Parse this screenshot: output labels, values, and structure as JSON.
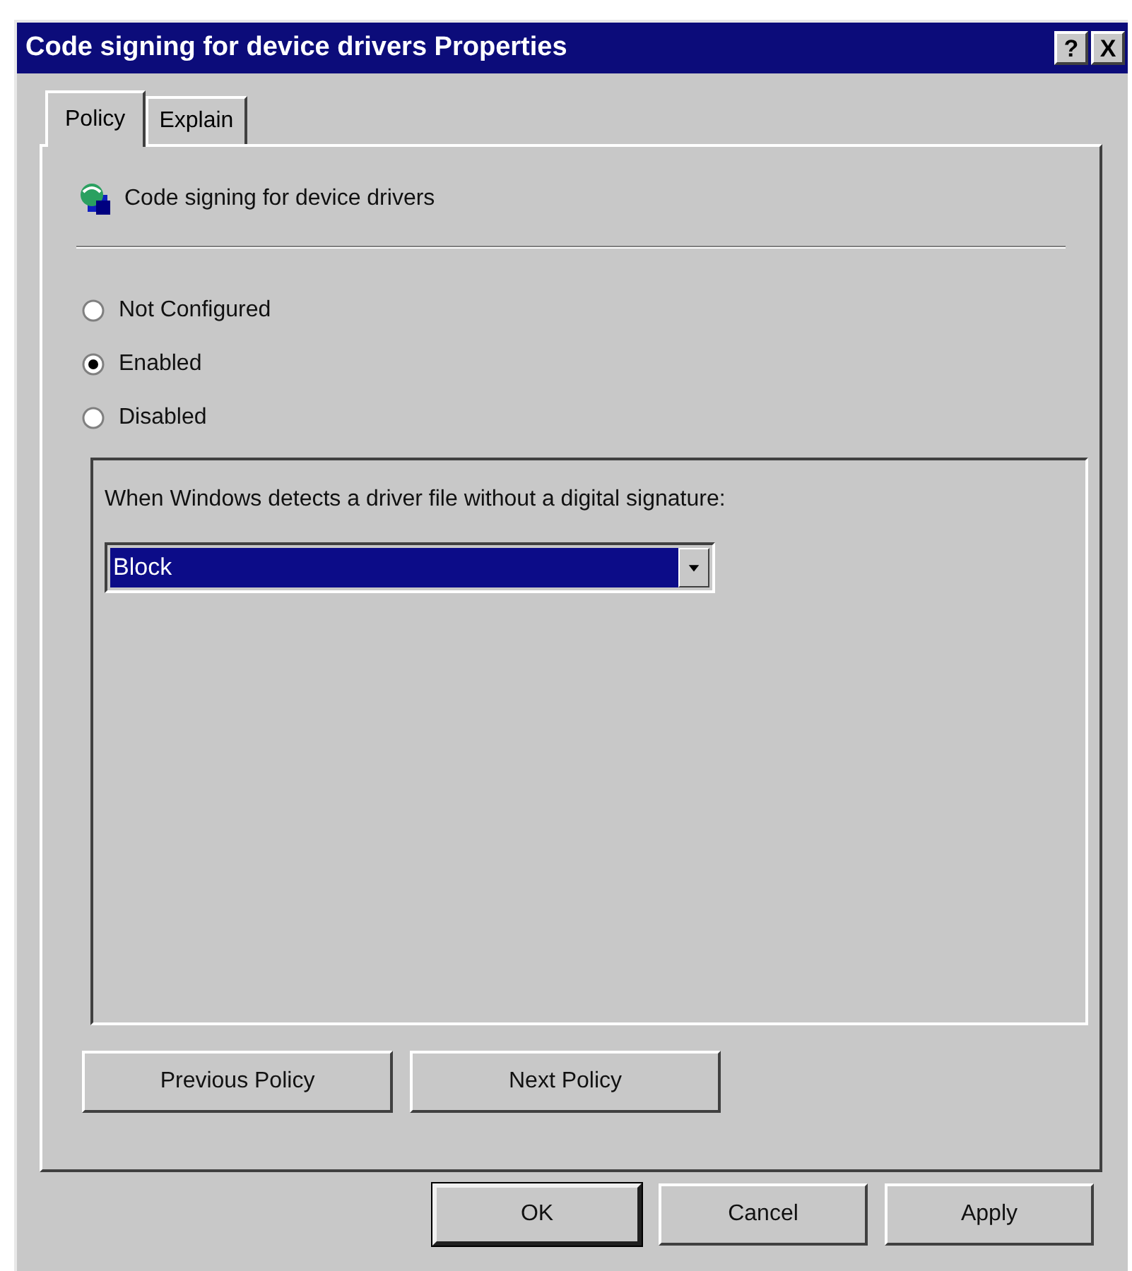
{
  "window": {
    "title": "Code signing for device drivers Properties",
    "title_buttons": [
      "?",
      "X"
    ]
  },
  "tabs": [
    {
      "label": "Policy",
      "selected": true
    },
    {
      "label": "Explain",
      "selected": false
    }
  ],
  "policy": {
    "name": "Code signing for device drivers"
  },
  "options": [
    {
      "label": "Not Configured",
      "selected": false
    },
    {
      "label": "Enabled",
      "selected": true
    },
    {
      "label": "Disabled",
      "selected": false
    }
  ],
  "group": {
    "prompt": "When Windows detects a driver file without a digital signature:",
    "dropdown": {
      "value": "Block",
      "focused": true
    }
  },
  "nav_buttons": [
    {
      "label": "Previous Policy"
    },
    {
      "label": "Next Policy"
    }
  ],
  "buttons": [
    {
      "label": "OK",
      "default": true
    },
    {
      "label": "Cancel",
      "default": false
    },
    {
      "label": "Apply",
      "default": false
    }
  ]
}
